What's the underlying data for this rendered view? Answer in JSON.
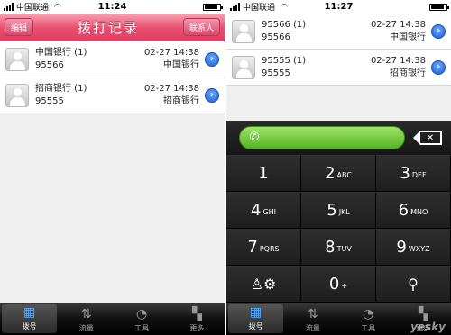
{
  "left": {
    "status": {
      "carrier": "中国联通",
      "time": "11:24",
      "battery_level": 0.9
    },
    "navbar": {
      "edit": "编辑",
      "title": "拨打记录",
      "contacts": "联系人"
    },
    "records": [
      {
        "name": "中国银行 (1)",
        "number": "95566",
        "date": "02-27 14:38",
        "bank": "中国银行"
      },
      {
        "name": "招商银行 (1)",
        "number": "95555",
        "date": "02-27 14:38",
        "bank": "招商银行"
      }
    ],
    "tabs": [
      {
        "label": "拨号",
        "icon": "dialpad-icon",
        "selected": true
      },
      {
        "label": "流量",
        "icon": "traffic-icon",
        "selected": false
      },
      {
        "label": "工具",
        "icon": "tools-icon",
        "selected": false
      },
      {
        "label": "更多",
        "icon": "more-icon",
        "selected": false
      }
    ]
  },
  "right": {
    "status": {
      "carrier": "中国联通",
      "time": "11:27",
      "battery_level": 0.9
    },
    "records": [
      {
        "number_line": "95566 (1)",
        "number": "95566",
        "date": "02-27 14:38",
        "bank": "中国银行"
      },
      {
        "number_line": "95555 (1)",
        "number": "95555",
        "date": "02-27 14:38",
        "bank": "招商银行"
      }
    ],
    "keys": [
      {
        "d": "1",
        "l": ""
      },
      {
        "d": "2",
        "l": "ABC"
      },
      {
        "d": "3",
        "l": "DEF"
      },
      {
        "d": "4",
        "l": "GHI"
      },
      {
        "d": "5",
        "l": "JKL"
      },
      {
        "d": "6",
        "l": "MNO"
      },
      {
        "d": "7",
        "l": "PQRS"
      },
      {
        "d": "8",
        "l": "TUV"
      },
      {
        "d": "9",
        "l": "WXYZ"
      },
      {
        "d": "",
        "l": "",
        "icon": "contact-settings-icon"
      },
      {
        "d": "0",
        "l": "+"
      },
      {
        "d": "",
        "l": "",
        "icon": "search-icon"
      }
    ],
    "tabs": [
      {
        "label": "拨号",
        "icon": "dialpad-icon",
        "selected": true
      },
      {
        "label": "流量",
        "icon": "traffic-icon",
        "selected": false
      },
      {
        "label": "工具",
        "icon": "tools-icon",
        "selected": false
      },
      {
        "label": "更多",
        "icon": "more-icon",
        "selected": false
      }
    ],
    "watermark": "yesky"
  },
  "colors": {
    "navbar": "#e84d6f",
    "call_button": "#6cc13a",
    "detail_disclosure": "#1a5fd6",
    "tabbar": "#111111",
    "keypad": "#1b1b1b"
  }
}
